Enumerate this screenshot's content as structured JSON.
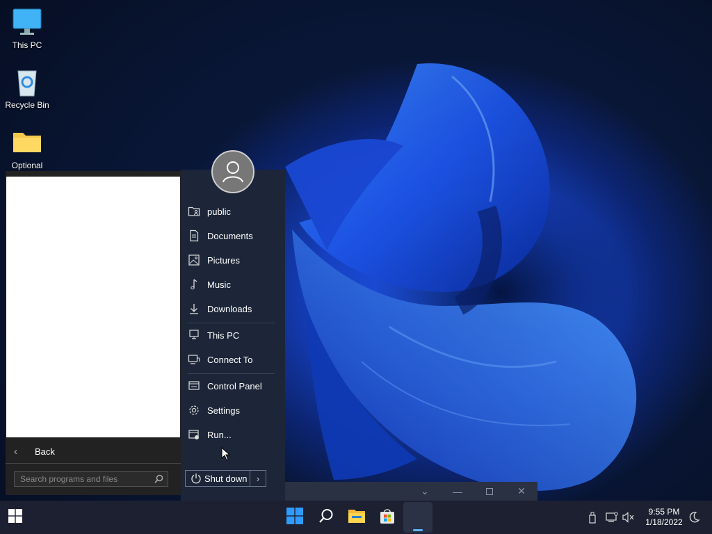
{
  "desktop": {
    "icons": [
      {
        "label": "This PC",
        "icon": "monitor-icon"
      },
      {
        "label": "Recycle Bin",
        "icon": "recycle-bin-icon"
      },
      {
        "label": "Optional",
        "icon": "folder-icon"
      }
    ]
  },
  "start_menu": {
    "user_icon": "user-avatar-icon",
    "items": [
      {
        "label": "public",
        "icon": "user-folder-icon"
      },
      {
        "label": "Documents",
        "icon": "document-icon"
      },
      {
        "label": "Pictures",
        "icon": "picture-icon"
      },
      {
        "label": "Music",
        "icon": "music-note-icon"
      },
      {
        "label": "Downloads",
        "icon": "download-arrow-icon"
      },
      {
        "label": "This PC",
        "icon": "computer-icon"
      },
      {
        "label": "Connect To",
        "icon": "connect-icon"
      },
      {
        "label": "Control Panel",
        "icon": "control-panel-icon"
      },
      {
        "label": "Settings",
        "icon": "gear-icon"
      },
      {
        "label": "Run...",
        "icon": "run-icon"
      }
    ],
    "back_label": "Back",
    "search_placeholder": "Search programs and files",
    "shutdown_label": "Shut down"
  },
  "taskbar": {
    "apps": [
      "start-icon",
      "search-icon",
      "file-explorer-icon",
      "store-icon",
      "open-window-icon"
    ],
    "tray": [
      "usb-eject-icon",
      "network-icon",
      "volume-muted-icon",
      "night-mode-icon"
    ],
    "time": "9:55 PM",
    "date": "1/18/2022"
  },
  "colors": {
    "accent": "#2f7ff0",
    "menu_bg": "#1c2638",
    "taskbar_bg": "#1c2030"
  }
}
